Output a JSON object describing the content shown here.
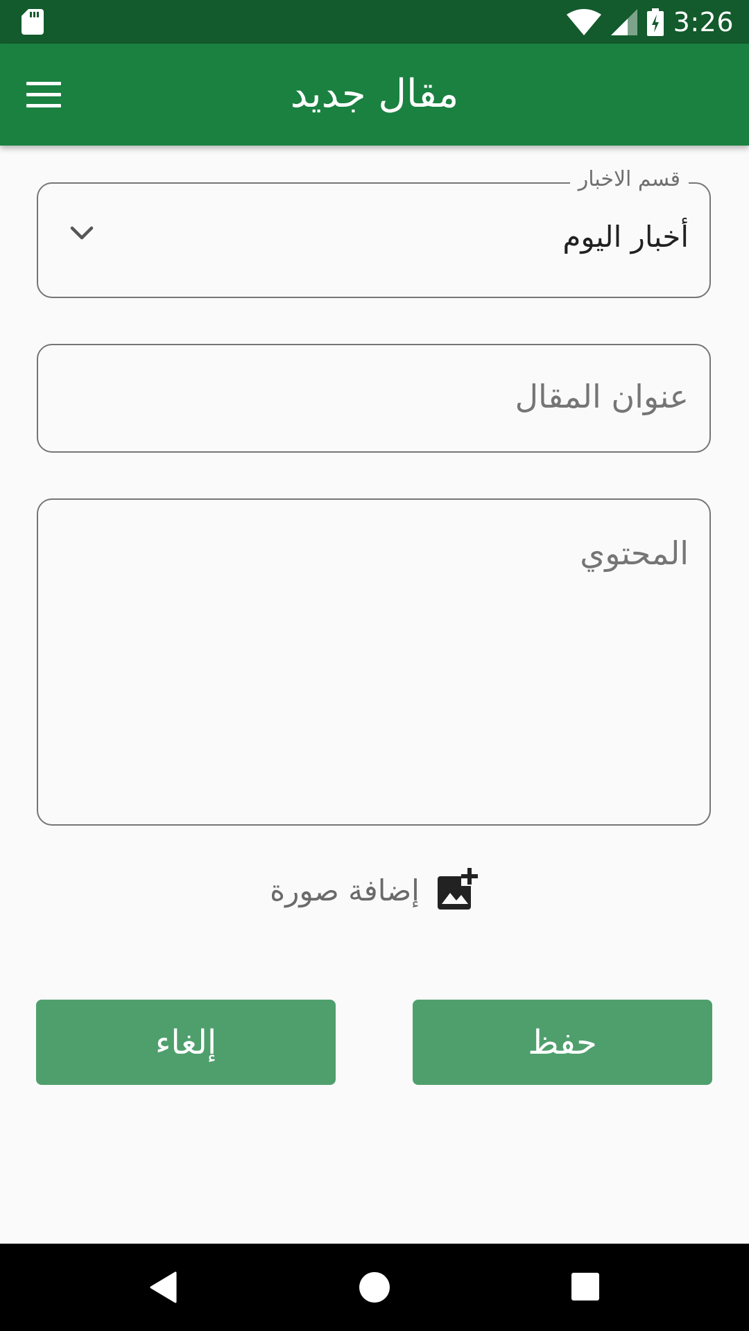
{
  "status_bar": {
    "time": "3:26"
  },
  "app_bar": {
    "title": "مقال جديد"
  },
  "form": {
    "category": {
      "label": "قسم الاخبار",
      "value": "أخبار اليوم"
    },
    "title_field": {
      "placeholder": "عنوان المقال"
    },
    "content_field": {
      "placeholder": "المحتوي"
    },
    "add_image_label": "إضافة صورة"
  },
  "buttons": {
    "save_label": "حفظ",
    "cancel_label": "إلغاء"
  },
  "colors": {
    "status_bar": "#135a2c",
    "app_bar": "#1a8140",
    "button": "#4f9f6d",
    "background": "#fafafa"
  },
  "icons": [
    "sd-card-icon",
    "wifi-icon",
    "cellular-signal-icon",
    "battery-charging-icon",
    "menu-icon",
    "chevron-down-icon",
    "add-photo-icon",
    "back-icon",
    "home-icon",
    "recents-icon"
  ]
}
